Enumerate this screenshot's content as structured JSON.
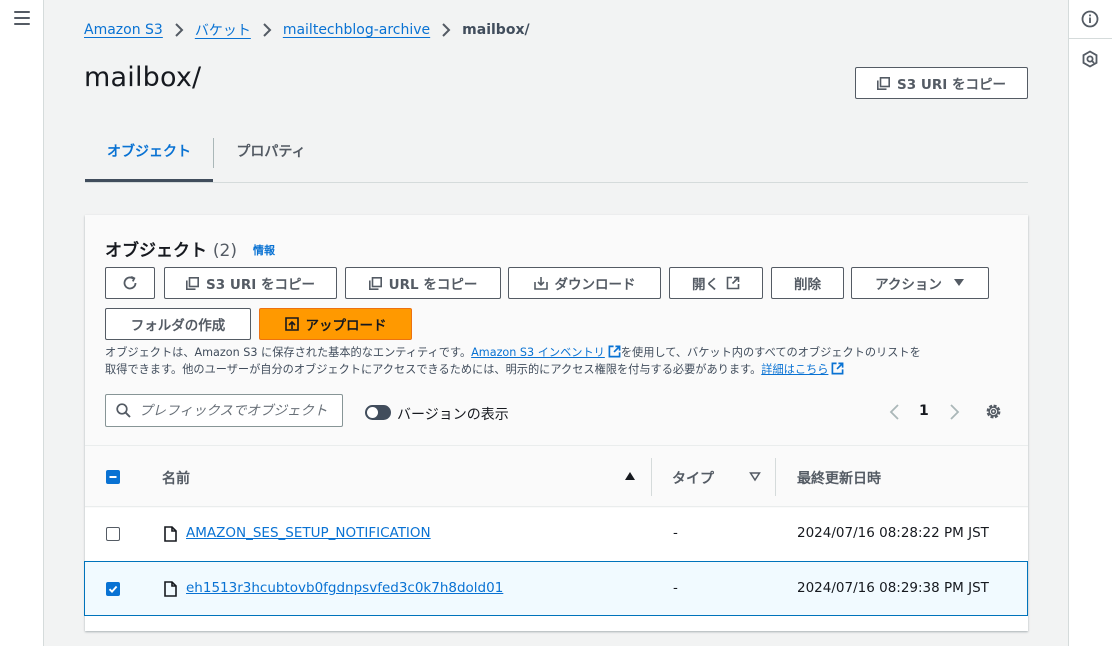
{
  "breadcrumb": {
    "items": [
      "Amazon S3",
      "バケット",
      "mailtechblog-archive"
    ],
    "current": "mailbox/"
  },
  "page": {
    "title": "mailbox/",
    "copy_s3_uri_label": "S3 URI をコピー"
  },
  "tabs": [
    {
      "label": "オブジェクト",
      "active": true
    },
    {
      "label": "プロパティ",
      "active": false
    }
  ],
  "objects_panel": {
    "title": "オブジェクト",
    "count": "(2)",
    "info_label": "情報",
    "toolbar": {
      "copy_s3_uri": "S3 URI をコピー",
      "copy_url": "URL をコピー",
      "download": "ダウンロード",
      "open": "開く",
      "delete": "削除",
      "actions": "アクション",
      "create_folder": "フォルダの作成",
      "upload": "アップロード"
    },
    "description": {
      "part1": "オブジェクトは、Amazon S3 に保存された基本的なエンティティです。",
      "inventory_link": "Amazon S3 インベントリ",
      "part2": "を使用して、バケット内のすべてのオブジェクトのリストを",
      "part3": "取得できます。他のユーザーが自分のオブジェクトにアクセスできるためには、明示的にアクセス権限を付与する必要があります。",
      "learn_more_link": "詳細はこちら"
    },
    "search": {
      "placeholder": "プレフィックスでオブジェクトを検索",
      "value": ""
    },
    "versions_toggle_label": "バージョンの表示",
    "versions_toggle_on": false,
    "pagination": {
      "current_page": "1"
    },
    "table": {
      "columns": {
        "name": "名前",
        "type": "タイプ",
        "last_modified": "最終更新日時"
      },
      "rows": [
        {
          "name": "AMAZON_SES_SETUP_NOTIFICATION",
          "type": "-",
          "last_modified": "2024/07/16 08:28:22 PM JST",
          "selected": false
        },
        {
          "name": "eh1513r3hcubtovb0fgdnpsvfed3c0k7h8dold01",
          "type": "-",
          "last_modified": "2024/07/16 08:29:38 PM JST",
          "selected": true
        }
      ]
    }
  },
  "colors": {
    "link": "#0972d3",
    "primary": "#ff9900",
    "selected_row": "#f1faff"
  }
}
